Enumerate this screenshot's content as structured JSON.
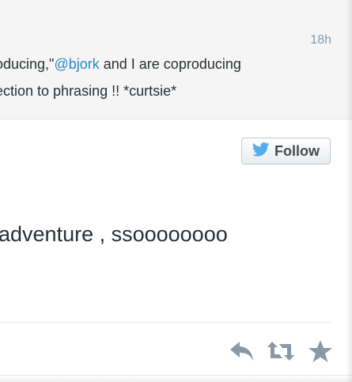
{
  "previous_tweet": {
    "timestamp": "18h",
    "line1_prefix": "oducing,\"",
    "line1_mention": "@bjork",
    "line1_suffix": " and I are coproducing",
    "line2": "ection to phrasing !! *curtsie*"
  },
  "main_tweet": {
    "follow_label": "Follow",
    "text": "adventure , ssoooooooo"
  },
  "actions": {
    "reply_icon": "reply-icon",
    "retweet_icon": "retweet-icon",
    "favorite_icon": "star-icon"
  },
  "colors": {
    "text": "#292f33",
    "mention": "#2a8bc4",
    "muted": "#8899a6",
    "twitter_blue": "#55acee",
    "action_gray": "#8899a6"
  }
}
